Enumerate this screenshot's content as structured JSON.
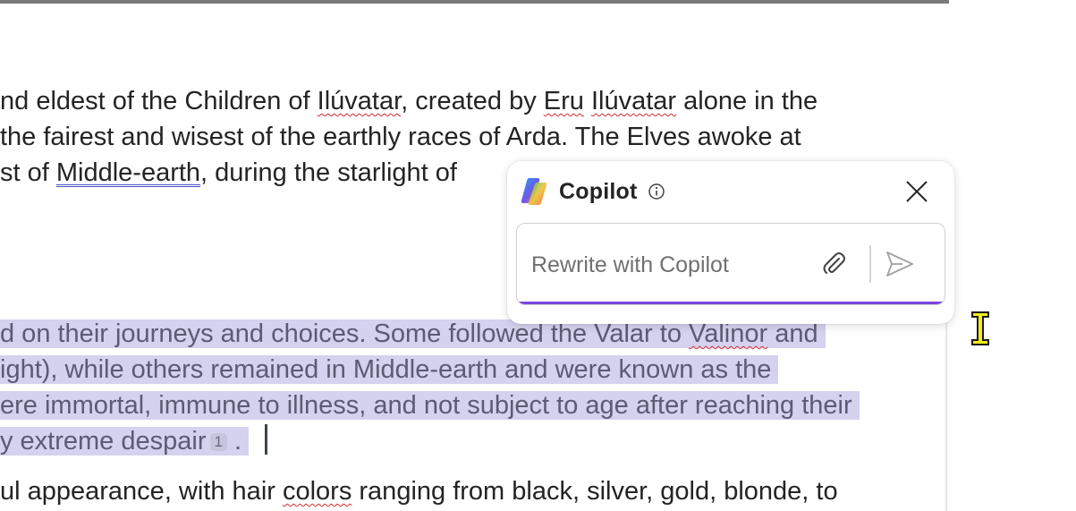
{
  "document": {
    "line1": {
      "a": "nd eldest of the Children of ",
      "b": "Ilúvatar",
      "c": ", created by ",
      "d": "Eru",
      "e": " ",
      "f": "Ilúvatar",
      "g": " alone in the"
    },
    "line2": "the fairest and wisest of the earthly races of Arda. The Elves awoke at",
    "line3": {
      "a": "st of ",
      "b": "Middle-earth",
      "c": ", during the starlight of"
    },
    "line4": {
      "a": "d on their journeys and choices. Some followed the Valar to ",
      "b": "Valinor",
      "c": " and"
    },
    "line5": "ight), while others remained in Middle-earth and were known as the",
    "line6": "ere immortal, immune to illness, and not subject to age after reaching their",
    "line7": {
      "a": "y extreme despair",
      "citation": "1",
      "b": "."
    },
    "line8": {
      "a": "ul appearance, with hair ",
      "b": "colors",
      "c": " ranging from black, silver, gold, blonde, to"
    }
  },
  "copilot": {
    "title": "Copilot",
    "input_placeholder": "Rewrite with Copilot",
    "input_value": "",
    "accent_color": "#7b43db"
  },
  "colors": {
    "selection": "#d4d2ef",
    "spelling_underline": "#d62d2d",
    "link_underline": "#4a55c6"
  },
  "icons": {
    "logo": "copilot-logo-icon",
    "info": "info-icon",
    "close": "close-icon",
    "attach": "paperclip-icon",
    "send": "send-icon",
    "cursor": "text-cursor-icon"
  }
}
